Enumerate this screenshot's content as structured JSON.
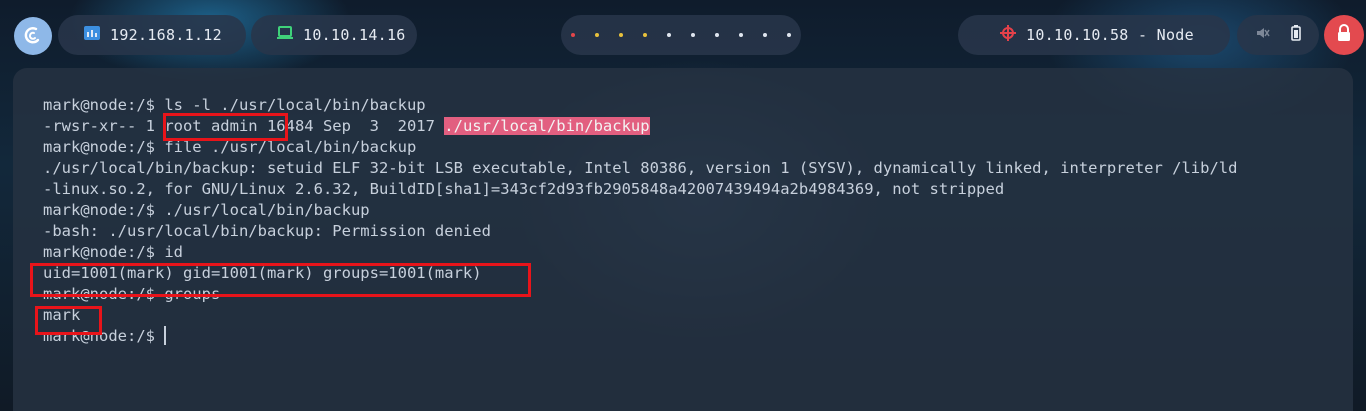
{
  "topbar": {
    "host_ip": "192.168.1.12",
    "vpn_ip": "10.10.14.16",
    "target": "10.10.10.58 - Node",
    "workspace_count": 10
  },
  "terminal": {
    "lines": [
      {
        "text": "mark@node:/$ ls -l ./usr/local/bin/backup"
      },
      {
        "pre": "-rwsr-xr-- 1 root admin 16484 Sep  3  2017 ",
        "hl": "./usr/local/bin/backup"
      },
      {
        "text": "mark@node:/$ file ./usr/local/bin/backup"
      },
      {
        "text": "./usr/local/bin/backup: setuid ELF 32-bit LSB executable, Intel 80386, version 1 (SYSV), dynamically linked, interpreter /lib/ld"
      },
      {
        "text": "-linux.so.2, for GNU/Linux 2.6.32, BuildID[sha1]=343cf2d93fb2905848a42007439494a2b4984369, not stripped"
      },
      {
        "text": "mark@node:/$ ./usr/local/bin/backup"
      },
      {
        "text": "-bash: ./usr/local/bin/backup: Permission denied"
      },
      {
        "text": "mark@node:/$ id"
      },
      {
        "text": "uid=1001(mark) gid=1001(mark) groups=1001(mark)"
      },
      {
        "text": "mark@node:/$ groups"
      },
      {
        "text": "mark"
      },
      {
        "text": "mark@node:/$ ",
        "cursor": true
      }
    ]
  },
  "colors": {
    "highlight": "#e25f80",
    "annotation_box": "#e8141a",
    "terminal_text": "#c7d0dc"
  }
}
